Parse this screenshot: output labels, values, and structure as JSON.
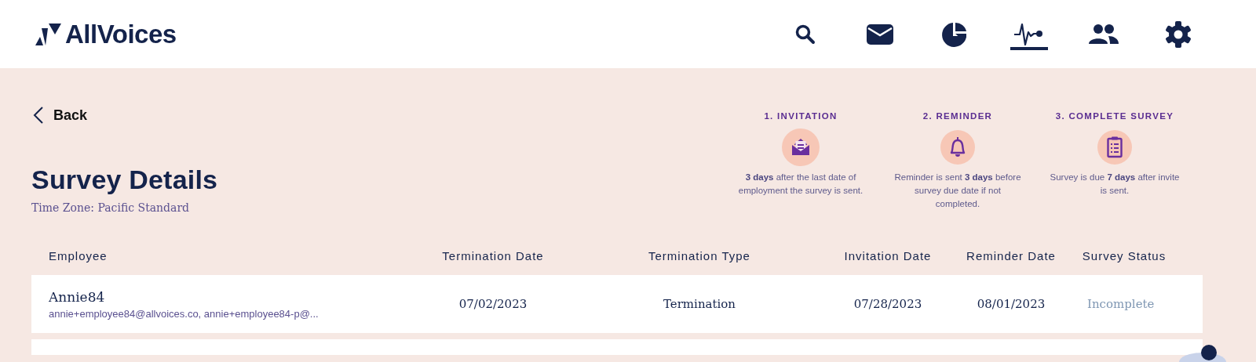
{
  "header": {
    "logo": "AllVoices",
    "nav": [
      {
        "selected": false
      },
      {
        "selected": false
      },
      {
        "selected": false
      },
      {
        "selected": true
      },
      {
        "selected": false
      },
      {
        "selected": false
      }
    ]
  },
  "back": "Back",
  "title": "Survey Details",
  "time_zone": "Time Zone: Pacific Standard",
  "steps": [
    {
      "label": "1. INVITATION",
      "description": "**3 days** after the last date of employment the survey is sent."
    },
    {
      "label": "2. REMINDER",
      "description": "Reminder is sent **3 days** before survey due date if not completed."
    },
    {
      "label": "3. COMPLETE SURVEY",
      "description": "Survey is due **7 days** after invite is sent."
    }
  ],
  "table": {
    "columns": [
      "Employee",
      "Termination Date",
      "Termination Type",
      "Invitation Date",
      "Reminder Date",
      "Survey Status"
    ],
    "rows": [
      {
        "name": "Annie84",
        "emails": "annie+employee84@allvoices.co, annie+employee84-p@...",
        "termination_date": "07/02/2023",
        "termination_type": "Termination",
        "invitation_date": "07/28/2023",
        "reminder_date": "08/01/2023",
        "status": "Incomplete"
      }
    ]
  }
}
